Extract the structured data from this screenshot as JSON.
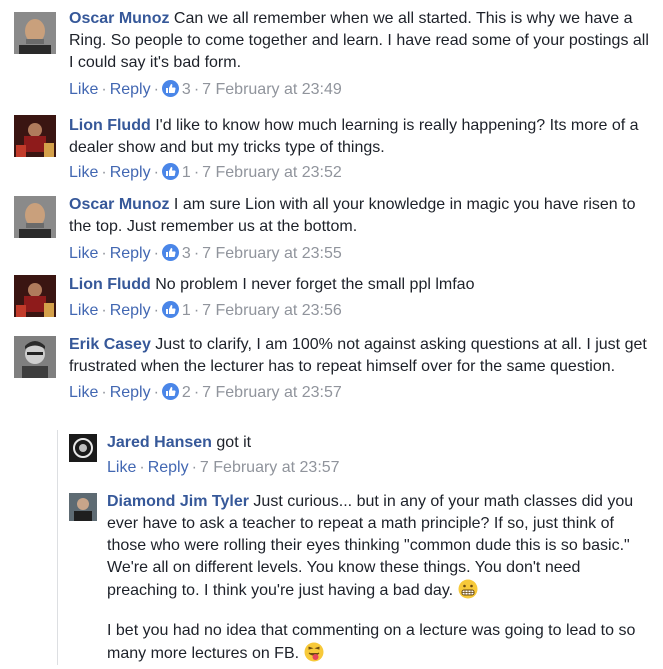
{
  "colors": {
    "author": "#365899",
    "action": "#4267b2",
    "meta": "#90949c",
    "text": "#1d2129",
    "like_badge": "#4a86e8"
  },
  "icons": {
    "like": "thumbs-up-icon",
    "grimace": "grimacing-emoji-icon",
    "tongue": "tongue-wink-emoji-icon"
  },
  "comments": [
    {
      "author": "Oscar Munoz",
      "text": "Can we all remember when we all started. This is why we have a Ring. So people to come together and learn. I have read some of your postings all I could say it's bad form.",
      "like": "Like",
      "reply": "Reply",
      "reactions": "3",
      "time": "7 February at 23:49"
    },
    {
      "author": "Lion Fludd",
      "text": "I'd like to know how much learning is really happening? Its more of a dealer show and but my tricks type of things.",
      "like": "Like",
      "reply": "Reply",
      "reactions": "1",
      "time": "7 February at 23:52"
    },
    {
      "author": "Oscar Munoz",
      "text": "I am sure Lion with all your knowledge in magic you have risen to the top. Just remember us at the bottom.",
      "like": "Like",
      "reply": "Reply",
      "reactions": "3",
      "time": "7 February at 23:55"
    },
    {
      "author": "Lion Fludd",
      "text": "No problem I never forget the small ppl lmfao",
      "like": "Like",
      "reply": "Reply",
      "reactions": "1",
      "time": "7 February at 23:56"
    },
    {
      "author": "Erik Casey",
      "text": "Just to clarify, I am 100% not against asking questions at all. I just get frustrated when the lecturer has to repeat himself over for the same question.",
      "like": "Like",
      "reply": "Reply",
      "reactions": "2",
      "time": "7 February at 23:57"
    }
  ],
  "replies": [
    {
      "author": "Jared Hansen",
      "text": "got it",
      "like": "Like",
      "reply": "Reply",
      "time": "7 February at 23:57"
    },
    {
      "author": "Diamond Jim Tyler",
      "text": "Just curious... but in any of your math classes did you ever have to ask a teacher to repeat a math principle? If so, just think of those who were rolling their eyes thinking \"common dude this is so basic.\" We're all on different levels. You know these things. You don't need preaching to. I think you're just having a bad day.",
      "text2": "I bet you had no idea that commenting on a lecture was going to lead to so many more lectures on FB."
    }
  ]
}
